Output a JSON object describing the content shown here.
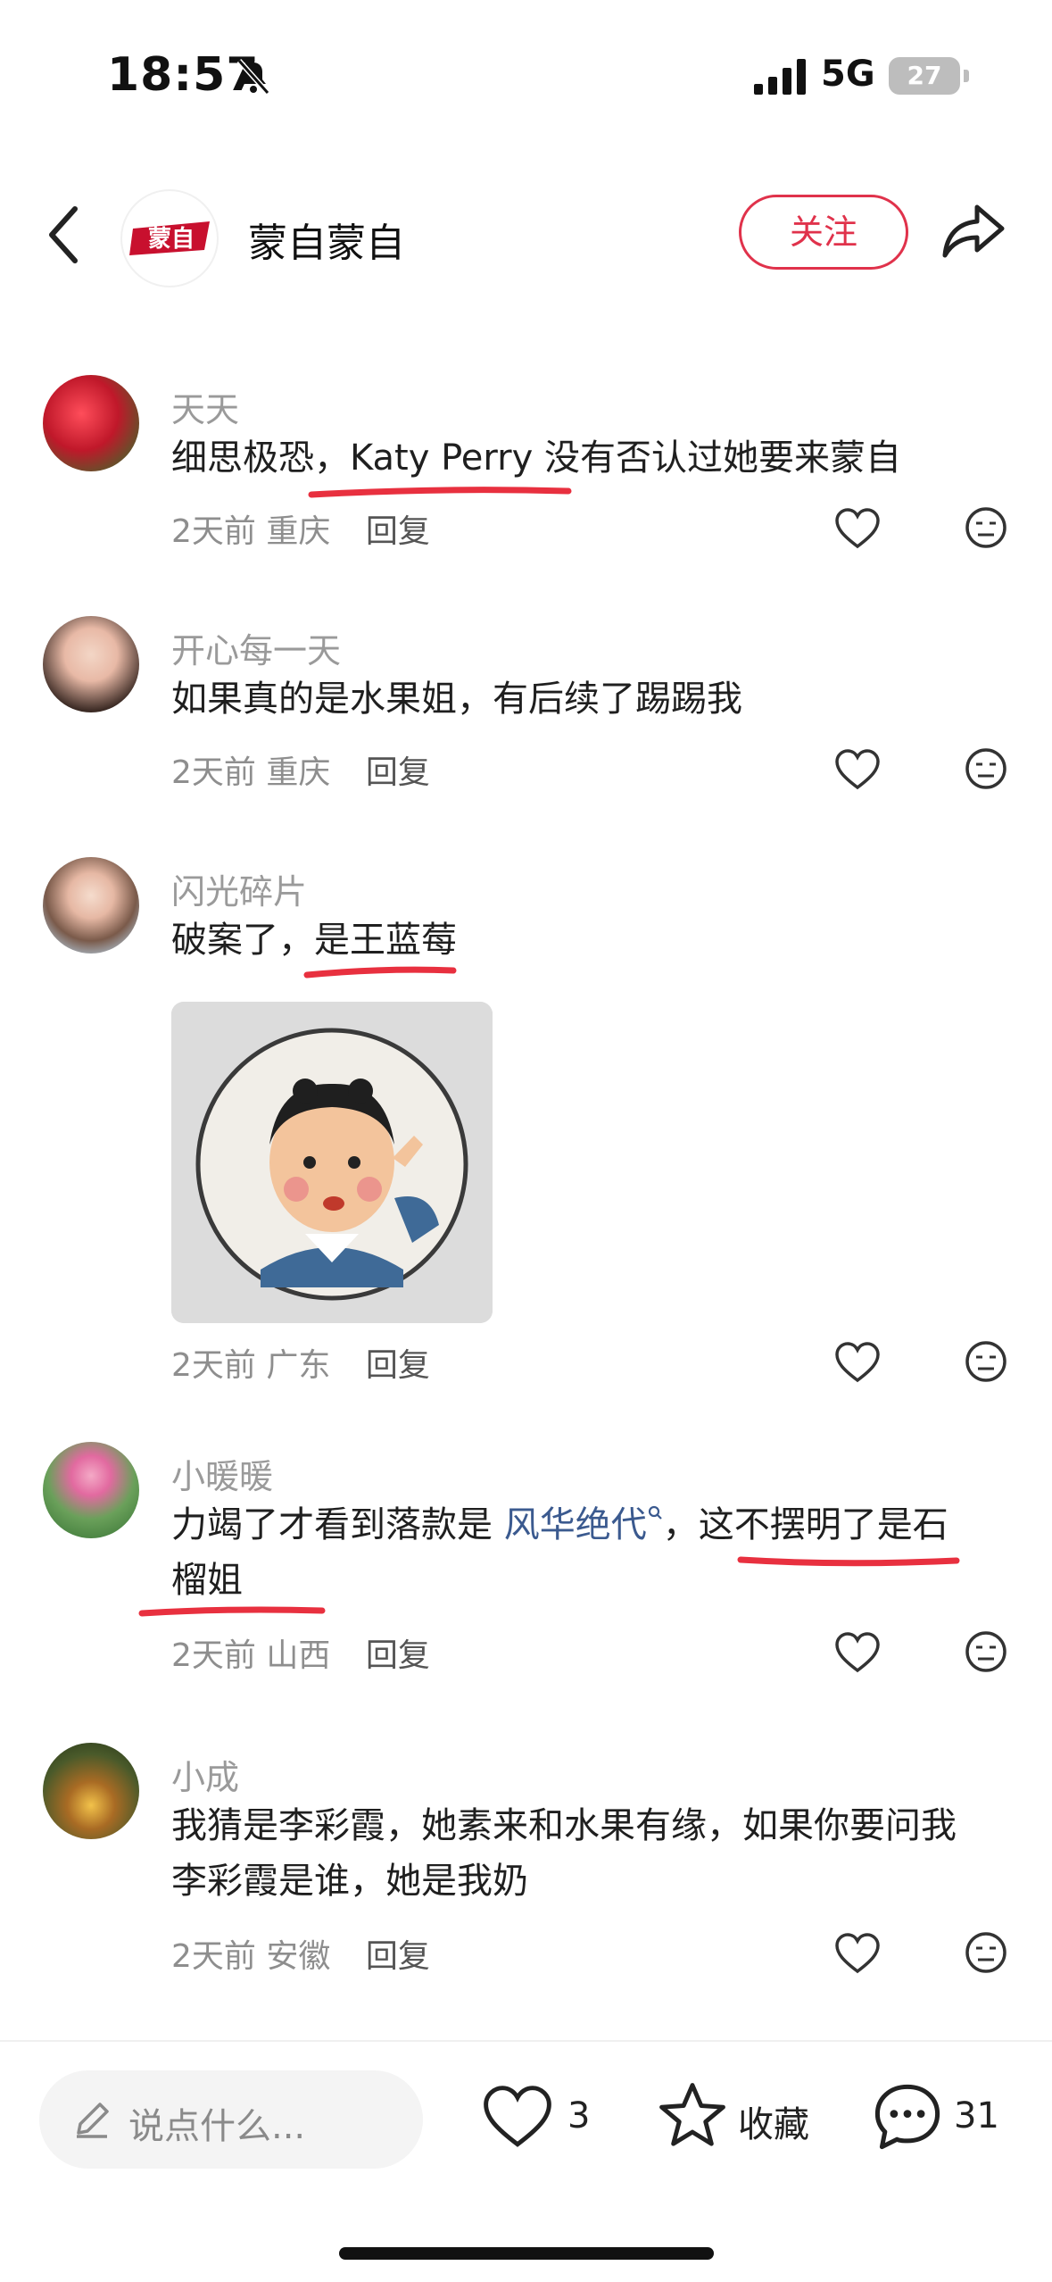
{
  "status": {
    "time": "18:57",
    "network": "5G",
    "battery": "27"
  },
  "header": {
    "author_name": "蒙自蒙自",
    "follow_label": "关注",
    "logo_text": "蒙自"
  },
  "comments": [
    {
      "name": "天天",
      "text": "细思极恐，Katy Perry 没有否认过她要来蒙自",
      "time": "2天前",
      "location": "重庆",
      "reply": "回复"
    },
    {
      "name": "开心每一天",
      "text": "如果真的是水果姐，有后续了踢踢我",
      "time": "2天前",
      "location": "重庆",
      "reply": "回复"
    },
    {
      "name": "闪光碎片",
      "text": "破案了，是王蓝莓",
      "time": "2天前",
      "location": "广东",
      "reply": "回复"
    },
    {
      "name": "小暖暖",
      "text_pre": "力竭了才看到落款是 ",
      "text_link": "风华绝代",
      "text_post": "，这不摆明了是石",
      "text_line2": "榴姐",
      "time": "2天前",
      "location": "山西",
      "reply": "回复"
    },
    {
      "name": "小成",
      "text_line1": "我猜是李彩霞，她素来和水果有缘，如果你要问我",
      "text_line2": "李彩霞是谁，她是我奶",
      "time": "2天前",
      "location": "安徽",
      "reply": "回复"
    }
  ],
  "bottom": {
    "input_placeholder": "说点什么...",
    "like_count": "3",
    "collect_label": "收藏",
    "comment_count": "31"
  },
  "colors": {
    "accent": "#e0324b",
    "underline": "#e8303f",
    "link": "#3b5a8f"
  }
}
